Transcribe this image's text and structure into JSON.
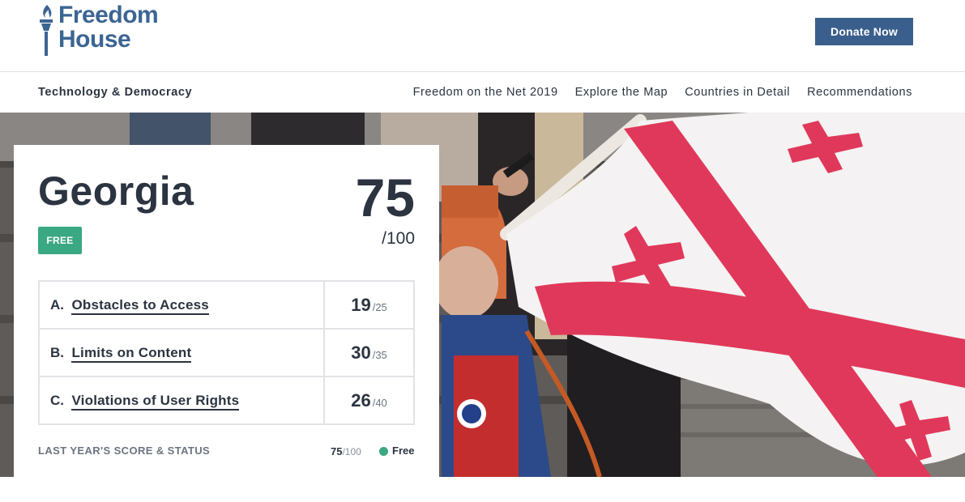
{
  "header": {
    "logo_line1": "Freedom",
    "logo_line2": "House",
    "donate_label": "Donate Now"
  },
  "subnav": {
    "section_title": "Technology & Democracy",
    "links": [
      "Freedom on the Net 2019",
      "Explore the Map",
      "Countries in Detail",
      "Recommendations"
    ]
  },
  "card": {
    "country": "Georgia",
    "status": "FREE",
    "total_score": "75",
    "total_max": "/100",
    "categories": [
      {
        "letter": "A.",
        "name": "Obstacles to Access",
        "score": "19",
        "max": "/25"
      },
      {
        "letter": "B.",
        "name": "Limits on Content",
        "score": "30",
        "max": "/35"
      },
      {
        "letter": "C.",
        "name": "Violations of User Rights",
        "score": "26",
        "max": "/40"
      }
    ],
    "last_year_label": "LAST YEAR'S SCORE & STATUS",
    "last_year_score": "75",
    "last_year_max": "/100",
    "last_year_status": "Free"
  },
  "colors": {
    "brand_blue": "#3b6593",
    "donate_bg": "#3b5f8c",
    "free_green": "#3aa882",
    "text_dark": "#2b3440",
    "flag_red": "#e0385a"
  },
  "icons": {
    "logo_mark": "torch-icon",
    "status_dot": "status-dot-icon"
  }
}
